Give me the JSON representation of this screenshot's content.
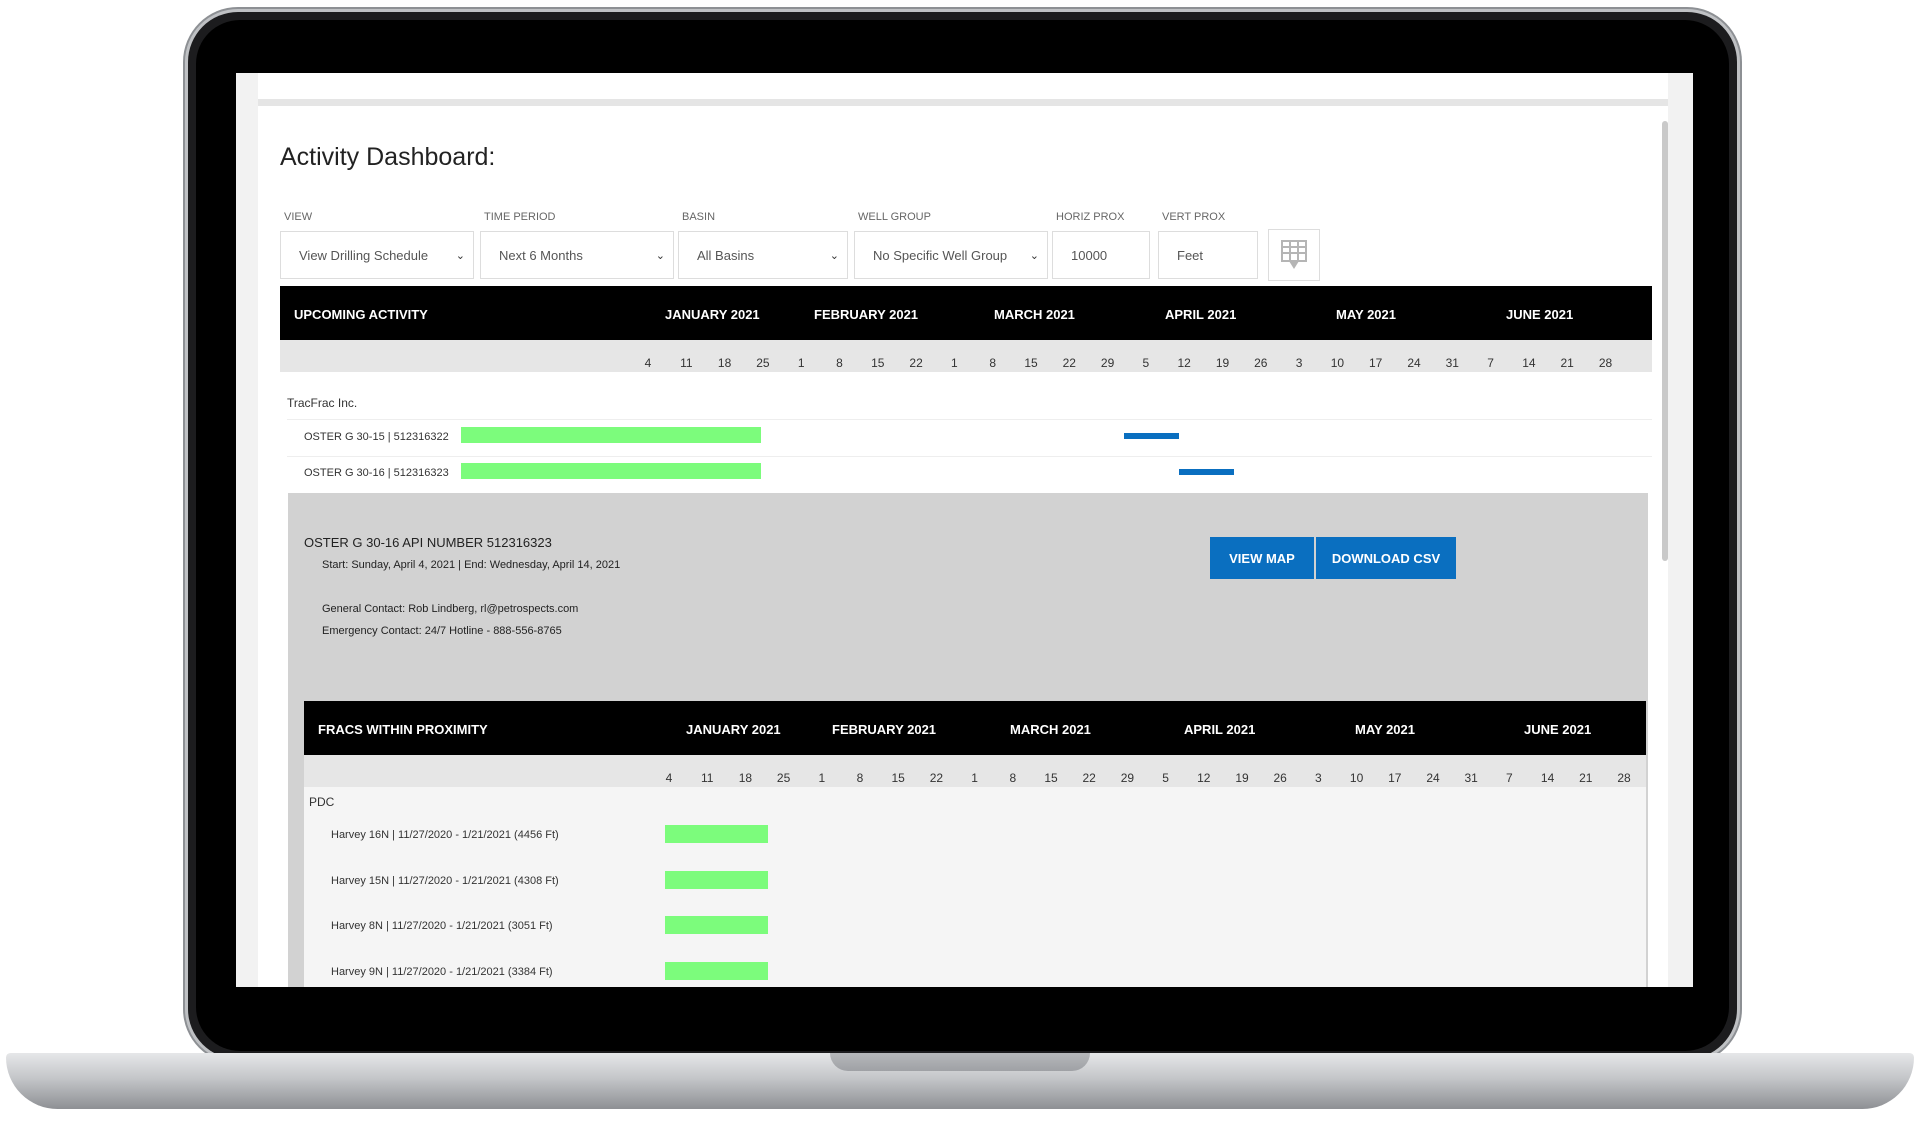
{
  "page": {
    "title": "Activity Dashboard:"
  },
  "filters": {
    "view": {
      "label": "VIEW",
      "value": "View Drilling Schedule"
    },
    "time_period": {
      "label": "TIME PERIOD",
      "value": "Next 6 Months"
    },
    "basin": {
      "label": "BASIN",
      "value": "All Basins"
    },
    "well_group": {
      "label": "WELL GROUP",
      "value": "No Specific Well Group"
    },
    "horiz_prox": {
      "label": "HORIZ PROX",
      "value": "10000"
    },
    "vert_prox": {
      "label": "VERT PROX",
      "value": "Feet"
    },
    "filter_icon": "filter-table-icon"
  },
  "months": [
    "JANUARY 2021",
    "FEBRUARY 2021",
    "MARCH 2021",
    "APRIL 2021",
    "MAY 2021",
    "JUNE 2021"
  ],
  "weeks": [
    "4",
    "11",
    "18",
    "25",
    "1",
    "8",
    "15",
    "22",
    "1",
    "8",
    "15",
    "22",
    "29",
    "5",
    "12",
    "19",
    "26",
    "3",
    "10",
    "17",
    "24",
    "31",
    "7",
    "14",
    "21",
    "28"
  ],
  "upcoming": {
    "header": "UPCOMING ACTIVITY",
    "group": "TracFrac Inc.",
    "rows": [
      {
        "label": "OSTER G 30-15 | 512316322"
      },
      {
        "label": "OSTER G 30-16 | 512316323"
      }
    ]
  },
  "detail": {
    "api_title": "OSTER G 30-16 API NUMBER 512316323",
    "dates": "Start: Sunday, April 4, 2021 | End: Wednesday, April 14, 2021",
    "general_contact": "General Contact: Rob Lindberg, rl@petrospects.com",
    "emergency_contact": "Emergency Contact: 24/7 Hotline - 888-556-8765",
    "view_map_label": "VIEW MAP",
    "download_csv_label": "DOWNLOAD CSV"
  },
  "fracs": {
    "header": "FRACS WITHIN PROXIMITY",
    "group": "PDC",
    "rows": [
      {
        "label": "Harvey 16N | 11/27/2020 - 1/21/2021 (4456 Ft)"
      },
      {
        "label": "Harvey 15N | 11/27/2020 - 1/21/2021 (4308 Ft)"
      },
      {
        "label": "Harvey 8N | 11/27/2020 - 1/21/2021 (3051 Ft)"
      },
      {
        "label": "Harvey 9N | 11/27/2020 - 1/21/2021 (3384 Ft)"
      }
    ]
  },
  "colors": {
    "header_bg": "#000000",
    "accent_blue": "#0a6fc0",
    "bar_green": "#7cfc7c",
    "panel_gray": "#d2d2d2"
  }
}
